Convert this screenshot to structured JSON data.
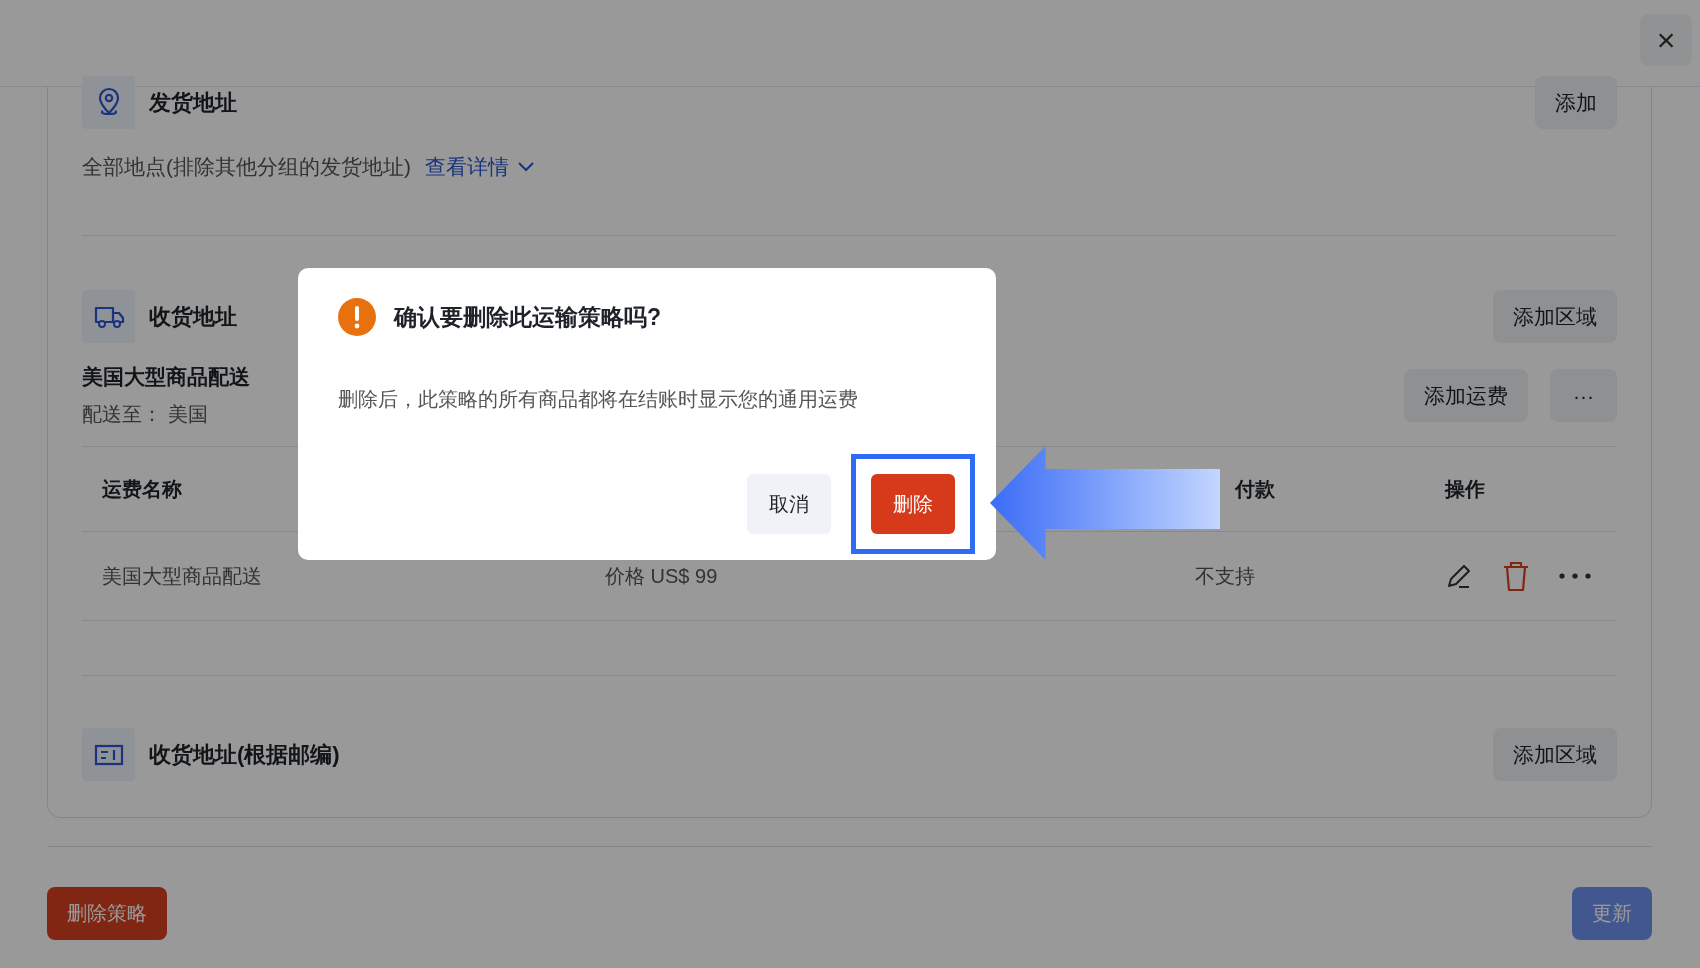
{
  "close_button": "×",
  "origin": {
    "title": "发货地址",
    "add_button": "添加",
    "summary": "全部地点(排除其他分组的发货地址)",
    "details_link": "查看详情"
  },
  "destination": {
    "title": "收货地址",
    "add_region_button": "添加区域",
    "zone_name": "美国大型商品配送",
    "ship_to": "配送至：  美国",
    "add_rate_button": "添加运费",
    "more_button": "···",
    "table": {
      "name_header": "运费名称",
      "column_3_header": "付款",
      "actions_header": "操作",
      "rows": [
        {
          "name": "美国大型商品配送",
          "price": "价格 US$ 99",
          "cod": "不支持"
        }
      ]
    }
  },
  "postal": {
    "title": "收货地址(根据邮编)",
    "add_region_button": "添加区域"
  },
  "footer": {
    "delete_button": "删除策略",
    "update_button": "更新",
    "update_disabled": true
  },
  "dialog": {
    "title": "确认要删除此运输策略吗?",
    "message": "删除后，此策略的所有商品都将在结账时显示您的通用运费",
    "cancel_button": "取消",
    "confirm_button": "删除"
  }
}
